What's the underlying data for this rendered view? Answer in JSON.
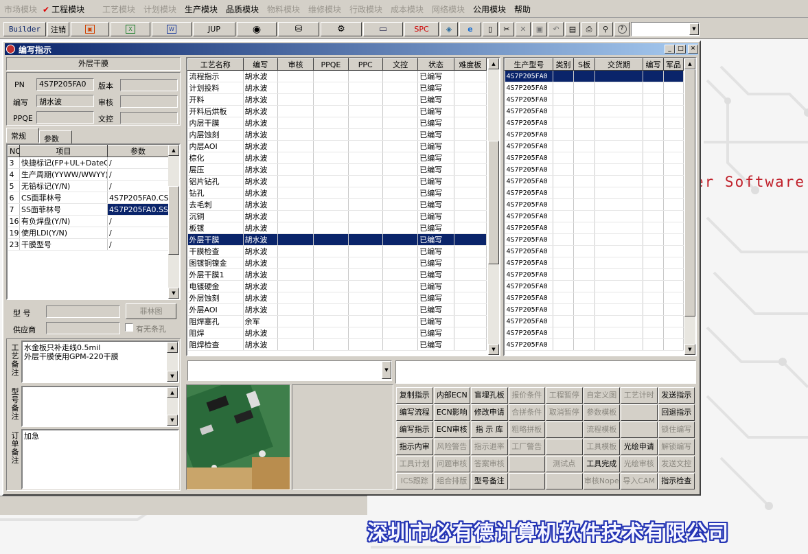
{
  "menu": [
    {
      "label": "市场模块",
      "enabled": false
    },
    {
      "label": "工程模块",
      "enabled": true,
      "checked": true
    },
    {
      "label": "工艺模块",
      "enabled": false
    },
    {
      "label": "计划模块",
      "enabled": false
    },
    {
      "label": "生产模块",
      "enabled": true
    },
    {
      "label": "品质模块",
      "enabled": true
    },
    {
      "label": "物料模块",
      "enabled": false
    },
    {
      "label": "维修模块",
      "enabled": false
    },
    {
      "label": "行政模块",
      "enabled": false
    },
    {
      "label": "成本模块",
      "enabled": false
    },
    {
      "label": "网络模块",
      "enabled": false
    },
    {
      "label": "公用模块",
      "enabled": true
    },
    {
      "label": "帮助",
      "enabled": true
    }
  ],
  "toolbar": {
    "builder": "Builder",
    "logout": "注销",
    "jup": "JUP",
    "spc": "SPC",
    "icons": [
      "report-icon",
      "excel-icon",
      "word-icon",
      "eye-icon",
      "database-icon",
      "tools-icon",
      "computer-icon",
      "3d-box-icon",
      "ie-icon",
      "new-doc-icon",
      "cut-icon",
      "delete-icon",
      "save-icon",
      "undo-icon",
      "preview-icon",
      "print-icon",
      "find-icon",
      "help-icon"
    ]
  },
  "window": {
    "title": "编写指示"
  },
  "header": {
    "process_name": "外层干膜",
    "pn_label": "PN",
    "pn_value": "4S7P205FA0",
    "version_label": "版本",
    "version_value": "",
    "author_label": "编写",
    "author_value": "胡水波",
    "review_label": "审核",
    "review_value": "",
    "ppqe_label": "PPQE",
    "ppqe_value": "",
    "doc_ctrl_label": "文控",
    "doc_ctrl_value": ""
  },
  "tabs": [
    "常规",
    "参数"
  ],
  "param_grid": {
    "columns": [
      "NO",
      "项目",
      "参数"
    ],
    "rows": [
      [
        "3",
        "快捷标记(FP+UL+DateC",
        "/"
      ],
      [
        "4",
        "生产周期(YYWW/WWYY)",
        "/"
      ],
      [
        "5",
        "无铅标记(Y/N)",
        "/"
      ],
      [
        "6",
        "CS面菲林号",
        "4S7P205FA0.CS"
      ],
      [
        "7",
        "SS面菲林号",
        "4S7P205FA0.SS"
      ],
      [
        "16",
        "有负焊盘(Y/N)",
        "/"
      ],
      [
        "19",
        "使用LDI(Y/N)",
        "/"
      ],
      [
        "23",
        "干膜型号",
        "/"
      ]
    ]
  },
  "model": {
    "label": "型  号",
    "value": "",
    "film_button": "菲林图"
  },
  "supplier": {
    "label": "供应商",
    "value": "",
    "barcode_label": "有无条孔"
  },
  "notes": {
    "process_label": "工艺备注",
    "process_text": "水金板只补走线0.5mil\n外层干膜使用GPM-220干膜",
    "model_label": "型号备注",
    "model_text": "",
    "order_label": "订单备注",
    "order_text": "加急"
  },
  "process_grid": {
    "columns": [
      "工艺名称",
      "编写",
      "审核",
      "PPQE",
      "PPC",
      "文控",
      "状态",
      "难度板"
    ],
    "rows": [
      [
        "流程指示",
        "胡水波",
        "已编写"
      ],
      [
        "计划投料",
        "胡水波",
        "已编写"
      ],
      [
        "开料",
        "胡水波",
        "已编写"
      ],
      [
        "开料后烘板",
        "胡水波",
        "已编写"
      ],
      [
        "内层干膜",
        "胡水波",
        "已编写"
      ],
      [
        "内层蚀刻",
        "胡水波",
        "已编写"
      ],
      [
        "内层AOI",
        "胡水波",
        "已编写"
      ],
      [
        "棕化",
        "胡水波",
        "已编写"
      ],
      [
        "层压",
        "胡水波",
        "已编写"
      ],
      [
        "铝片钻孔",
        "胡水波",
        "已编写"
      ],
      [
        "钻孔",
        "胡水波",
        "已编写"
      ],
      [
        "去毛刺",
        "胡水波",
        "已编写"
      ],
      [
        "沉铜",
        "胡水波",
        "已编写"
      ],
      [
        "板镀",
        "胡水波",
        "已编写"
      ],
      [
        "外层干膜",
        "胡水波",
        "已编写"
      ],
      [
        "干膜检查",
        "胡水波",
        "已编写"
      ],
      [
        "图镀铜镍金",
        "胡水波",
        "已编写"
      ],
      [
        "外层干膜1",
        "胡水波",
        "已编写"
      ],
      [
        "电镀硬金",
        "胡水波",
        "已编写"
      ],
      [
        "外层蚀刻",
        "胡水波",
        "已编写"
      ],
      [
        "外层AOI",
        "胡水波",
        "已编写"
      ],
      [
        "阻焊塞孔",
        "余军",
        "已编写"
      ],
      [
        "阻焊",
        "胡水波",
        "已编写"
      ],
      [
        "阻焊检查",
        "胡水波",
        "已编写"
      ]
    ],
    "selected_index": 14
  },
  "model_grid": {
    "columns": [
      "生产型号",
      "类别",
      "S板",
      "交货期",
      "编写",
      "军品"
    ],
    "value": "4S7P205FA0",
    "row_count": 24
  },
  "buttons": [
    [
      {
        "l": "复制指示",
        "e": true
      },
      {
        "l": "内部ECN",
        "e": true
      },
      {
        "l": "盲埋孔板",
        "e": true
      },
      {
        "l": "报价条件",
        "e": false
      },
      {
        "l": "工程暂停",
        "e": false
      },
      {
        "l": "自定义图",
        "e": false
      },
      {
        "l": "工艺计时",
        "e": false
      },
      {
        "l": "发送指示",
        "e": true
      }
    ],
    [
      {
        "l": "编写流程",
        "e": true
      },
      {
        "l": "ECN影响",
        "e": true
      },
      {
        "l": "修改申请",
        "e": true
      },
      {
        "l": "合拼条件",
        "e": false
      },
      {
        "l": "取消暂停",
        "e": false
      },
      {
        "l": "参数模板",
        "e": false
      },
      {
        "l": "",
        "e": false
      },
      {
        "l": "回退指示",
        "e": true
      }
    ],
    [
      {
        "l": "编写指示",
        "e": true
      },
      {
        "l": "ECN审核",
        "e": true
      },
      {
        "l": "指 示 库",
        "e": true
      },
      {
        "l": "粗略拼板",
        "e": false
      },
      {
        "l": "",
        "e": false
      },
      {
        "l": "流程模板",
        "e": false
      },
      {
        "l": "",
        "e": false
      },
      {
        "l": "锁住编写",
        "e": false
      }
    ],
    [
      {
        "l": "指示内审",
        "e": true
      },
      {
        "l": "风险警告",
        "e": false
      },
      {
        "l": "指示退率",
        "e": false
      },
      {
        "l": "工厂警告",
        "e": false
      },
      {
        "l": "",
        "e": false
      },
      {
        "l": "工具模板",
        "e": false
      },
      {
        "l": "光绘申请",
        "e": true
      },
      {
        "l": "解锁编写",
        "e": false
      }
    ],
    [
      {
        "l": "工具计划",
        "e": false
      },
      {
        "l": "问题审核",
        "e": false
      },
      {
        "l": "答案审核",
        "e": false
      },
      {
        "l": "",
        "e": false
      },
      {
        "l": "测试点",
        "e": false
      },
      {
        "l": "工具完成",
        "e": true
      },
      {
        "l": "光绘审核",
        "e": false
      },
      {
        "l": "发送文控",
        "e": false
      }
    ],
    [
      {
        "l": "ICS跟踪",
        "e": false
      },
      {
        "l": "组合排版",
        "e": false
      },
      {
        "l": "型号备注",
        "e": true
      },
      {
        "l": "",
        "e": false
      },
      {
        "l": "",
        "e": false
      },
      {
        "l": "审核Nope",
        "e": false
      },
      {
        "l": "导入CAM",
        "e": false
      },
      {
        "l": "指示检查",
        "e": true
      }
    ]
  ],
  "background": {
    "text": "er Software",
    "company": "深圳市必有德计算机软件技术有限公司"
  }
}
